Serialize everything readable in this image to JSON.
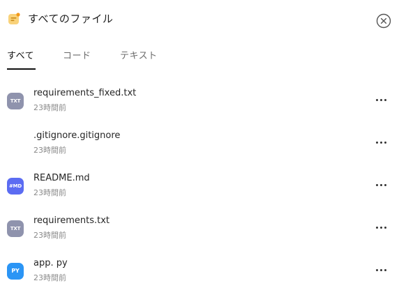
{
  "header": {
    "title": "すべてのファイル",
    "icon": "file-folder-icon",
    "close_icon": "close-circle-icon"
  },
  "tabs": [
    {
      "label": "すべて",
      "active": true
    },
    {
      "label": "コード",
      "active": false
    },
    {
      "label": "テキスト",
      "active": false
    }
  ],
  "files": [
    {
      "name": "requirements_fixed.txt",
      "time": "23時間前",
      "badge": "TXT",
      "type": "txt"
    },
    {
      "name": ".gitignore.gitignore",
      "time": "23時間前",
      "badge": "",
      "type": "none"
    },
    {
      "name": "README.md",
      "time": "23時間前",
      "badge": "#MD",
      "type": "md"
    },
    {
      "name": "requirements.txt",
      "time": "23時間前",
      "badge": "TXT",
      "type": "txt"
    },
    {
      "name": "app. py",
      "time": "23時間前",
      "badge": "PY",
      "type": "py"
    }
  ],
  "colors": {
    "txt_badge": "#8f93ad",
    "md_badge": "#5b6cf2",
    "py_badge": "#2b95f5",
    "header_icon": "#f7c23c"
  }
}
